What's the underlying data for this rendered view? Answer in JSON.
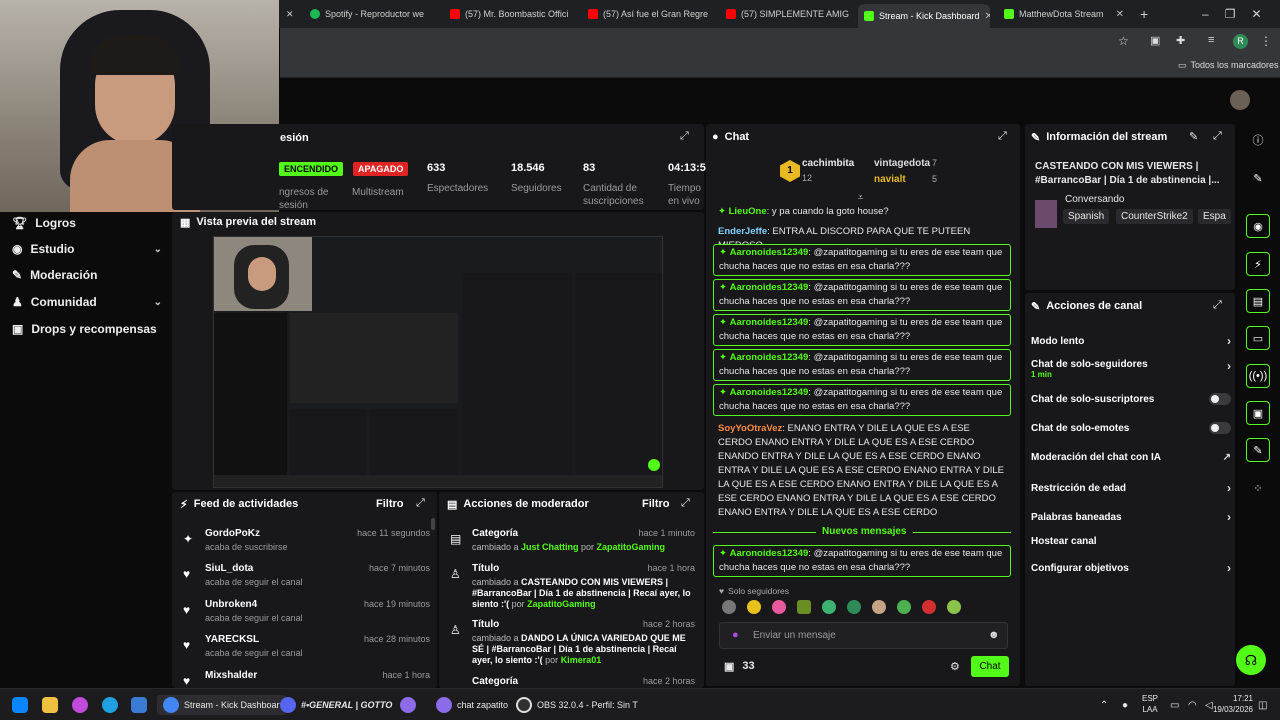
{
  "browser": {
    "tabs": [
      {
        "label": "Spotify - Reproductor web",
        "color": "#1db954"
      },
      {
        "label": "(57) Mr. Boombastic Offici",
        "color": "#ff0000"
      },
      {
        "label": "(57) Así fue el Gran Regre",
        "color": "#ff0000"
      },
      {
        "label": "(57) SIMPLEMENTE AMIG",
        "color": "#ff0000"
      },
      {
        "label": "Stream - Kick Dashboard",
        "color": "#53fc18"
      },
      {
        "label": "MatthewDota Stream",
        "color": "#53fc18"
      }
    ],
    "new_tab": "+",
    "bookmarks_label": "Todos los marcadores",
    "profile_initial": "R"
  },
  "sidebar": {
    "items": [
      {
        "label": "Logros"
      },
      {
        "label": "Estudio"
      },
      {
        "label": "Moderación"
      },
      {
        "label": "Comunidad"
      },
      {
        "label": "Drops y recompensas"
      }
    ]
  },
  "session": {
    "title": "esión",
    "status_on": "ENCENDIDO",
    "status_off": "APAGADO",
    "stats": [
      {
        "value": "",
        "label": "ngresos de\nsesión"
      },
      {
        "value": "",
        "label": "Multistream"
      },
      {
        "value": "633",
        "label": "Espectadores"
      },
      {
        "value": "18.546",
        "label": "Seguidores"
      },
      {
        "value": "83",
        "label": "Cantidad de\nsuscripciones"
      },
      {
        "value": "04:13:5",
        "label": "Tiempo\nen vivo"
      }
    ]
  },
  "preview": {
    "title": "Vista previa del stream"
  },
  "feed": {
    "title": "Feed de actividades",
    "filter": "Filtro",
    "items": [
      {
        "name": "GordoPoKz",
        "sub": "acaba de suscribirse",
        "time": "hace 11 segundos",
        "icon": "✦"
      },
      {
        "name": "SiuL_dota",
        "sub": "acaba de seguir el canal",
        "time": "hace 7 minutos",
        "icon": "♥"
      },
      {
        "name": "Unbroken4",
        "sub": "acaba de seguir el canal",
        "time": "hace 19 minutos",
        "icon": "♥"
      },
      {
        "name": "YARECKSL",
        "sub": "acaba de seguir el canal",
        "time": "hace 28 minutos",
        "icon": "♥"
      },
      {
        "name": "Mixshalder",
        "sub": "",
        "time": "hace 1 hora",
        "icon": "♥"
      }
    ]
  },
  "modactions": {
    "title": "Acciones de moderador",
    "filter": "Filtro",
    "items": [
      {
        "title": "Categoría",
        "time": "hace 1 minuto",
        "pre": "cambiado a ",
        "val": "Just Chatting",
        "mid": " por ",
        "user": "ZapatitoGaming"
      },
      {
        "title": "Título",
        "time": "hace 1 hora",
        "pre": "cambiado a ",
        "val": "CASTEANDO CON MIS VIEWERS | #BarrancoBar | Día 1 de abstinencia | Recaí ayer, lo siento :'(",
        "mid": " por ",
        "user": "ZapatitoGaming"
      },
      {
        "title": "Título",
        "time": "hace 2 horas",
        "pre": "cambiado a ",
        "val": "DANDO LA ÚNICA VARIEDAD QUE ME SÉ | #BarrancoBar | Día 1 de abstinencia | Recaí ayer, lo siento :'(",
        "mid": " por ",
        "user": "Kimera01"
      },
      {
        "title": "Categoría",
        "time": "hace 2 horas",
        "pre": "",
        "val": "",
        "mid": "",
        "user": ""
      }
    ]
  },
  "chat": {
    "title": "Chat",
    "top": {
      "rank": "1",
      "name1": "cachimbita",
      "count1": "12",
      "name2": "vintagedota",
      "count2": "7",
      "name3": "navialt",
      "count3": "5"
    },
    "messages": [
      {
        "user": "LieuOne",
        "text": ": y pa cuando la goto house?",
        "color": "#53fc18"
      },
      {
        "user": "EnderJeffe",
        "text": ": ENTRA AL DISCORD PARA QUE TE PUTEEN MIEDOSO",
        "color": "#7fd3ff"
      },
      {
        "user": "Aaronoides12349",
        "text": ": @zapatitogaming si tu eres de ese team que chucha haces que no estas en esa charla???",
        "color": "#53fc18"
      },
      {
        "user": "Aaronoides12349",
        "text": ": @zapatitogaming si tu eres de ese team que chucha haces que no estas en esa charla???",
        "color": "#53fc18"
      },
      {
        "user": "Aaronoides12349",
        "text": ": @zapatitogaming si tu eres de ese team que chucha haces que no estas en esa charla???",
        "color": "#53fc18"
      },
      {
        "user": "Aaronoides12349",
        "text": ": @zapatitogaming si tu eres de ese team que chucha haces que no estas en esa charla???",
        "color": "#53fc18"
      },
      {
        "user": "Aaronoides12349",
        "text": ": @zapatitogaming si tu eres de ese team que chucha haces que no estas en esa charla???",
        "color": "#53fc18"
      },
      {
        "user": "SoyYoOtraVez",
        "text": ": ENANO ENTRA Y DILE LA QUE ES A ESE CERDO ENANO ENTRA Y DILE LA QUE ES A ESE CERDO ENANDO ENTRA Y DILE LA QUE ES A ESE CERDO ENANO ENTRA Y DILE LA QUE ES A ESE CERDO ENANO ENTRA Y DILE LA QUE ES A ESE CERDO ENANO ENTRA Y DILE LA QUE ES A ESE CERDO ENANO ENTRA Y DILE LA QUE ES A ESE CERDO ENANO ENTRA Y DILE LA QUE ES A ESE CERDO",
        "color": "#ff8c42"
      },
      {
        "user": "Aaronoides12349",
        "text": ": @zapatitogaming si tu eres de ese team que chucha haces que no estas en esa charla???",
        "color": "#53fc18"
      }
    ],
    "new_messages": "Nuevos mensajes",
    "followers_only": "Solo seguidores",
    "input_placeholder": "Enviar un mensaje",
    "viewer_count": "33",
    "send": "Chat"
  },
  "streaminfo": {
    "title": "Información del stream",
    "stream_title": "CASTEANDO CON MIS VIEWERS | #BarrancoBar | Día 1 de abstinencia |...",
    "category": "Conversando",
    "tags": [
      "Spanish",
      "CounterStrike2",
      "Espa"
    ]
  },
  "channelactions": {
    "title": "Acciones de canal",
    "items": [
      {
        "label": "Modo lento",
        "sub": "",
        "control": "›"
      },
      {
        "label": "Chat de solo-seguidores",
        "sub": "1 min",
        "control": "›"
      },
      {
        "label": "Chat de solo-suscriptores",
        "sub": "",
        "control": "toggle"
      },
      {
        "label": "Chat de solo-emotes",
        "sub": "",
        "control": "toggle"
      },
      {
        "label": "Moderación del chat con IA",
        "sub": "",
        "control": "↗"
      },
      {
        "label": "Restricción de edad",
        "sub": "",
        "control": "›"
      },
      {
        "label": "Palabras baneadas",
        "sub": "",
        "control": "›"
      },
      {
        "label": "Hostear canal",
        "sub": "",
        "control": ""
      },
      {
        "label": "Configurar objetivos",
        "sub": "",
        "control": "›"
      }
    ]
  },
  "taskbar": {
    "apps": [
      {
        "label": "Stream - Kick Dashboar",
        "color": "#4285f4"
      },
      {
        "label": "#•GENERAL | GOTTO",
        "color": "#5865f2"
      },
      {
        "label": "",
        "color": "#8b6be8"
      },
      {
        "label": "chat zapatito",
        "color": "#8b6be8"
      },
      {
        "label": "OBS 32.0.4 - Perfil: Sin T",
        "color": "#303030"
      }
    ],
    "lang": "ESP",
    "lang2": "LAA",
    "time": "17:21",
    "date": "19/03/2026"
  },
  "colors": {
    "accent": "#53fc18",
    "panel": "#18181b",
    "bg": "#0b0b0c",
    "live": "#ff2d2d"
  }
}
